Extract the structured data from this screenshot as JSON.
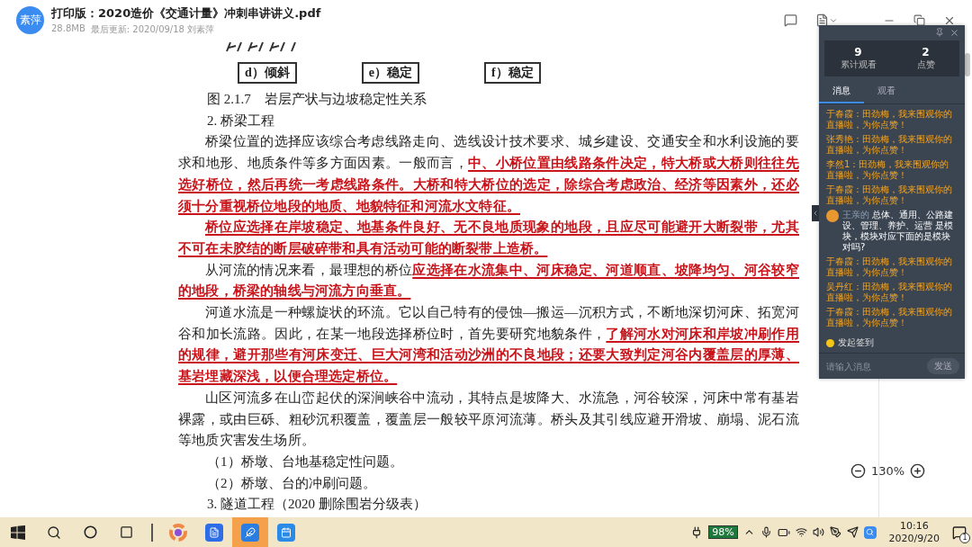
{
  "header": {
    "avatar": "素萍",
    "title": "打印版：2020造价《交通计量》冲刺串讲讲义.pdf",
    "size": "28.8MB",
    "updated": "最后更新: 2020/09/18 刘素萍"
  },
  "document": {
    "figure_labels": [
      "d）倾斜",
      "e）稳定",
      "f）稳定"
    ],
    "caption": "图 2.1.7　岩层产状与边坡稳定性关系",
    "blocks": [
      {
        "kind": "heading",
        "text": "2. 桥梁工程"
      },
      {
        "kind": "paragraph",
        "segments": [
          {
            "text": "桥梁位置的选择应该综合考虑线路走向、选线设计技术要求、城乡建设、交通安全和水利设施的要求和地形、地质条件等多方面因素。一般而言，",
            "highlight": false
          },
          {
            "text": "中、小桥位置由线路条件决定，特大桥或大桥则往往先选好桥位，然后再统一考虑线路条件。大桥和特大桥位的选定，除综合考虑政治、经济等因素外，还必须十分重视桥位地段的地质、地貌特征和河流水文特征。",
            "highlight": true
          }
        ]
      },
      {
        "kind": "paragraph",
        "segments": [
          {
            "text": "桥位应选择在岸坡稳定、地基条件良好、无不良地质现象的地段，且应尽可能避开大断裂带，尤其不可在未胶结的断层破碎带和具有活动可能的断裂带上造桥。",
            "highlight": true
          }
        ]
      },
      {
        "kind": "paragraph",
        "segments": [
          {
            "text": "从河流的情况来看，最理想的桥位",
            "highlight": false
          },
          {
            "text": "应选择在水流集中、河床稳定、河道顺直、坡降均匀、河谷较窄的地段，桥梁的轴线与河流方向垂直。",
            "highlight": true
          }
        ]
      },
      {
        "kind": "paragraph",
        "segments": [
          {
            "text": "河道水流是一种螺旋状的环流。它以自己特有的侵蚀—搬运—沉积方式，不断地深切河床、拓宽河谷和加长流路。因此，在某一地段选择桥位时，首先要研究地貌条件，",
            "highlight": false
          },
          {
            "text": "了解河水对河床和岸坡冲刷作用的规律，避开那些有河床变迁、巨大河湾和活动沙洲的不良地段；还要大致判定河谷内覆盖层的厚薄、基岩埋藏深浅，以便合理选定桥位。",
            "highlight": true
          }
        ]
      },
      {
        "kind": "paragraph",
        "segments": [
          {
            "text": "山区河流多在山峦起伏的深涧峡谷中流动，其特点是坡降大、水流急，河谷较深，河床中常有基岩裸露，或由巨砾、粗砂沉积覆盖，覆盖层一般较平原河流薄。桥头及其引线应避开滑坡、崩塌、泥石流等地质灾害发生场所。",
            "highlight": false
          }
        ]
      },
      {
        "kind": "item",
        "text": "（1）桥墩、台地基稳定性问题。"
      },
      {
        "kind": "item",
        "text": "（2）桥墩、台的冲刷问题。"
      },
      {
        "kind": "heading",
        "text": "3. 隧道工程（2020 删除围岩分级表）"
      }
    ]
  },
  "chat": {
    "stats": [
      {
        "value": "9",
        "label": "累计观看"
      },
      {
        "value": "2",
        "label": "点赞"
      }
    ],
    "tabs": [
      {
        "label": "消息",
        "selected": true
      },
      {
        "label": "观看",
        "selected": false
      }
    ],
    "messages": [
      {
        "kind": "chat",
        "text": "于春霞：田劲梅，我来围观你的直播啦，为你点赞！"
      },
      {
        "kind": "chat",
        "text": "张秀艳：田劲梅，我来围观你的直播啦，为你点赞！"
      },
      {
        "kind": "chat",
        "text": "李然1：田劲梅，我来围观你的直播啦，为你点赞！"
      },
      {
        "kind": "chat",
        "text": "于春霞：田劲梅，我来围观你的直播啦，为你点赞！"
      },
      {
        "kind": "question",
        "name": "王亲的",
        "text": "总体、通用、公路建设、管理、养护、运营 是模块，模块对应下面的是模块对吗?"
      },
      {
        "kind": "chat",
        "text": "于春霞：田劲梅，我来围观你的直播啦，为你点赞！"
      },
      {
        "kind": "chat",
        "text": "吴丹红：田劲梅，我来围观你的直播啦，为你点赞！"
      },
      {
        "kind": "chat",
        "text": "于春霞：田劲梅，我来围观你的直播啦，为你点赞！"
      }
    ],
    "sign_in": "发起签到",
    "input_placeholder": "请输入消息",
    "send": "发送"
  },
  "zoom": "130%",
  "taskbar": {
    "battery": "98%",
    "time": "10:16",
    "date": "2020/9/20",
    "notifications": "1"
  }
}
